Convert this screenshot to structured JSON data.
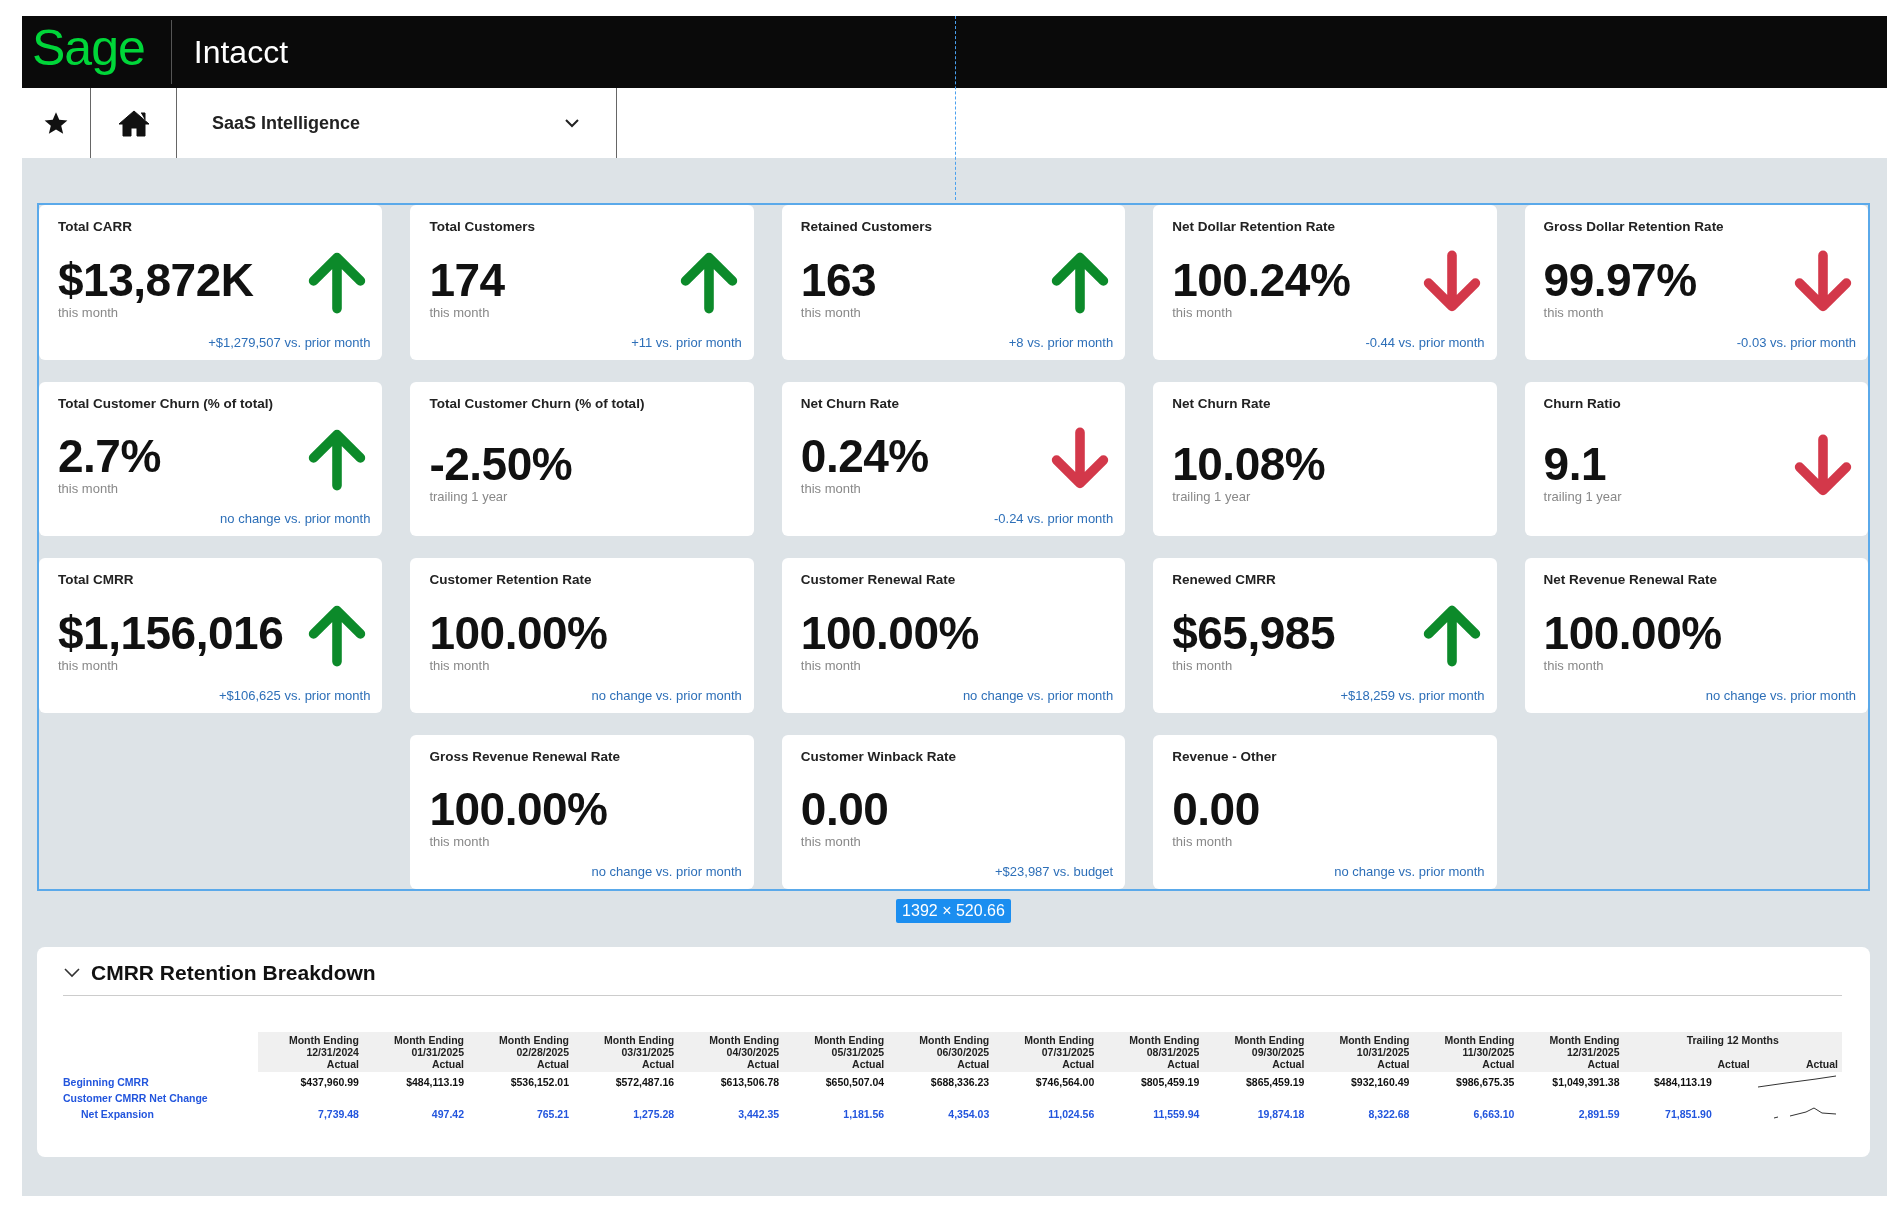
{
  "header": {
    "logo": "Sage",
    "product": "Intacct"
  },
  "nav": {
    "menu": "SaaS Intelligence"
  },
  "size_badge": "1392 × 520.66",
  "card_rows": [
    [
      {
        "title": "Total CARR",
        "value": "$13,872K",
        "period": "this month",
        "kind": "up",
        "comparison": "+$1,279,507 vs. prior month"
      },
      {
        "title": "Total Customers",
        "value": "174",
        "period": "this month",
        "kind": "up",
        "comparison": "+11 vs. prior month"
      },
      {
        "title": "Retained Customers",
        "value": "163",
        "period": "this month",
        "kind": "up",
        "comparison": "+8 vs. prior month"
      },
      {
        "title": "Net Dollar Retention Rate",
        "value": "100.24%",
        "period": "this month",
        "kind": "down",
        "comparison": "-0.44 vs. prior month"
      },
      {
        "title": "Gross Dollar Retention Rate",
        "value": "99.97%",
        "period": "this month",
        "kind": "down",
        "comparison": "-0.03 vs. prior month"
      }
    ],
    [
      {
        "title": "Total Customer Churn (% of total)",
        "value": "2.7%",
        "period": "this month",
        "kind": "up",
        "comparison": "no change vs. prior month"
      },
      {
        "title": "Total Customer Churn (% of total)",
        "value": "-2.50%",
        "period": "trailing 1 year",
        "kind": "plain"
      },
      {
        "title": "Net Churn Rate",
        "value": "0.24%",
        "period": "this month",
        "kind": "down",
        "comparison": "-0.24 vs. prior month"
      },
      {
        "title": "Net Churn Rate",
        "value": "10.08%",
        "period": "trailing 1 year",
        "kind": "plain"
      },
      {
        "title": "Churn Ratio",
        "value": "9.1",
        "period": "trailing 1 year",
        "kind": "down"
      }
    ],
    [
      {
        "title": "Total CMRR",
        "value": "$1,156,016",
        "period": "this month",
        "kind": "up",
        "comparison": "+$106,625 vs. prior month"
      },
      {
        "title": "Customer Retention Rate",
        "value": "100.00%",
        "period": "this month",
        "kind": "plain",
        "comparison": "no change vs. prior month"
      },
      {
        "title": "Customer Renewal Rate",
        "value": "100.00%",
        "period": "this month",
        "kind": "plain",
        "comparison": "no change vs. prior month"
      },
      {
        "title": "Renewed CMRR",
        "value": "$65,985",
        "period": "this month",
        "kind": "up",
        "comparison": "+$18,259 vs. prior month"
      },
      {
        "title": "Net Revenue Renewal Rate",
        "value": "100.00%",
        "period": "this month",
        "kind": "plain",
        "comparison": "no change vs. prior month"
      }
    ],
    [
      {
        "title": "Gross Revenue Renewal Rate",
        "value": "100.00%",
        "period": "this month",
        "kind": "plain",
        "comparison": "no change vs. prior month"
      },
      {
        "title": "Customer Winback Rate",
        "value": "0.00",
        "period": "this month",
        "kind": "plain",
        "comparison": "+$23,987 vs. budget"
      },
      {
        "title": "Revenue - Other",
        "value": "0.00",
        "period": "this month",
        "kind": "plain",
        "comparison": "no change vs. prior month"
      }
    ]
  ],
  "breakdown": {
    "title": "CMRR Retention Breakdown",
    "expanded": true,
    "columns": [
      {
        "lines": [
          "Month Ending",
          "12/31/2024",
          "Actual"
        ]
      },
      {
        "lines": [
          "Month Ending",
          "01/31/2025",
          "Actual"
        ]
      },
      {
        "lines": [
          "Month Ending",
          "02/28/2025",
          "Actual"
        ]
      },
      {
        "lines": [
          "Month Ending",
          "03/31/2025",
          "Actual"
        ]
      },
      {
        "lines": [
          "Month Ending",
          "04/30/2025",
          "Actual"
        ]
      },
      {
        "lines": [
          "Month Ending",
          "05/31/2025",
          "Actual"
        ]
      },
      {
        "lines": [
          "Month Ending",
          "06/30/2025",
          "Actual"
        ]
      },
      {
        "lines": [
          "Month Ending",
          "07/31/2025",
          "Actual"
        ]
      },
      {
        "lines": [
          "Month Ending",
          "08/31/2025",
          "Actual"
        ]
      },
      {
        "lines": [
          "Month Ending",
          "09/30/2025",
          "Actual"
        ]
      },
      {
        "lines": [
          "Month Ending",
          "10/31/2025",
          "Actual"
        ]
      },
      {
        "lines": [
          "Month Ending",
          "11/30/2025",
          "Actual"
        ]
      },
      {
        "lines": [
          "Month Ending",
          "12/31/2025",
          "Actual"
        ]
      }
    ],
    "trailing": {
      "group": "Trailing 12 Months",
      "columns": [
        "Actual",
        "Actual"
      ]
    },
    "rows": [
      {
        "label": "Beginning CMRR",
        "kind": "total",
        "values": [
          "$437,960.99",
          "$484,113.19",
          "$536,152.01",
          "$572,487.16",
          "$613,506.78",
          "$650,507.04",
          "$688,336.23",
          "$746,564.00",
          "$805,459.19",
          "$865,459.19",
          "$932,160.49",
          "$986,675.35",
          "$1,049,391.38"
        ],
        "trailing": "$484,113.19"
      },
      {
        "label": "Customer CMRR Net Change",
        "kind": "group"
      },
      {
        "label": "Net Expansion",
        "kind": "detail",
        "values": [
          "7,739.48",
          "497.42",
          "765.21",
          "1,275.28",
          "3,442.35",
          "1,181.56",
          "4,354.03",
          "11,024.56",
          "11,559.94",
          "19,874.18",
          "8,322.68",
          "6,663.10",
          "2,891.59"
        ],
        "trailing": "71,851.90"
      }
    ]
  }
}
